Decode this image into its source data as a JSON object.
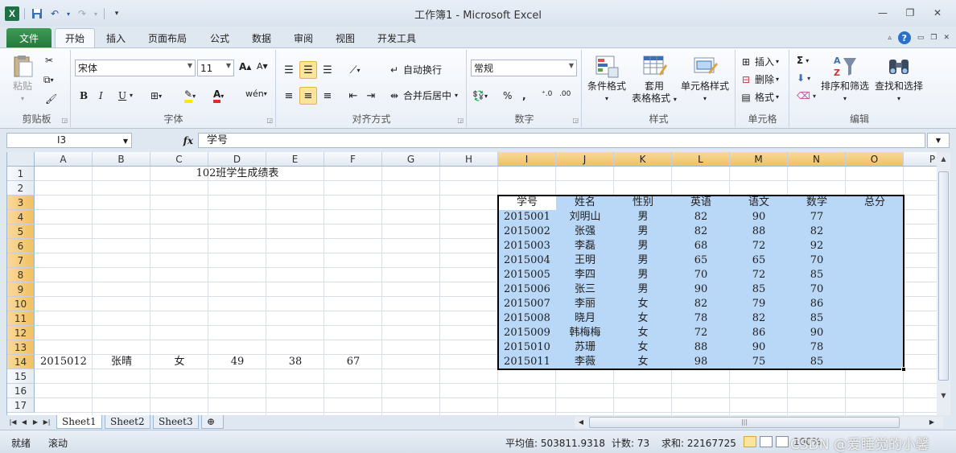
{
  "window": {
    "title": "工作簿1  -  Microsoft Excel",
    "logo": "X",
    "qat": [
      "save-icon",
      "undo-icon",
      "redo-icon",
      "customize-icon"
    ]
  },
  "tabs": {
    "file": "文件",
    "items": [
      "开始",
      "插入",
      "页面布局",
      "公式",
      "数据",
      "审阅",
      "视图",
      "开发工具"
    ]
  },
  "ribbon": {
    "clipboard": {
      "label": "剪贴板",
      "paste": "粘贴"
    },
    "font": {
      "label": "字体",
      "name": "宋体",
      "size": "11",
      "bold": "B",
      "italic": "I",
      "underline": "U"
    },
    "alignment": {
      "label": "对齐方式",
      "wrap": "自动换行",
      "merge": "合并后居中"
    },
    "number": {
      "label": "数字",
      "format": "常规",
      "percent": "%",
      "comma": ","
    },
    "styles": {
      "label": "样式",
      "conditional": "条件格式",
      "table_line1": "套用",
      "table_line2": "表格格式",
      "cell_styles": "单元格样式"
    },
    "cells": {
      "label": "单元格",
      "insert": "插入",
      "delete": "删除",
      "format": "格式"
    },
    "editing": {
      "label": "编辑",
      "sum": "Σ",
      "sort": "排序和筛选",
      "find": "查找和选择"
    }
  },
  "formula_bar": {
    "name_box": "I3",
    "fx": "fx",
    "content": "学号"
  },
  "grid": {
    "columns": [
      "A",
      "B",
      "C",
      "D",
      "E",
      "F",
      "G",
      "H",
      "I",
      "J",
      "K",
      "L",
      "M",
      "N",
      "O",
      "P"
    ],
    "rows": [
      "1",
      "2",
      "3",
      "4",
      "5",
      "6",
      "7",
      "8",
      "9",
      "10",
      "11",
      "12",
      "13",
      "14",
      "15",
      "16",
      "17"
    ],
    "selected_columns": [
      "I",
      "J",
      "K",
      "L",
      "M",
      "N",
      "O"
    ],
    "selected_rows": [
      "3",
      "4",
      "5",
      "6",
      "7",
      "8",
      "9",
      "10",
      "11",
      "12",
      "13",
      "14"
    ],
    "title_cell": {
      "ref": "C1",
      "value": "102班学生成绩表"
    },
    "row14": [
      "2015012",
      "张晴",
      "女",
      "49",
      "38",
      "67"
    ],
    "table": {
      "headers": [
        "学号",
        "姓名",
        "性别",
        "英语",
        "语文",
        "数学",
        "总分"
      ],
      "rows": [
        [
          "2015001",
          "刘明山",
          "男",
          "82",
          "90",
          "77",
          ""
        ],
        [
          "2015002",
          "张强",
          "男",
          "82",
          "88",
          "82",
          ""
        ],
        [
          "2015003",
          "李磊",
          "男",
          "68",
          "72",
          "92",
          ""
        ],
        [
          "2015004",
          "王明",
          "男",
          "65",
          "65",
          "70",
          ""
        ],
        [
          "2015005",
          "李四",
          "男",
          "70",
          "72",
          "85",
          ""
        ],
        [
          "2015006",
          "张三",
          "男",
          "90",
          "85",
          "70",
          ""
        ],
        [
          "2015007",
          "李丽",
          "女",
          "82",
          "79",
          "86",
          ""
        ],
        [
          "2015008",
          "晓月",
          "女",
          "78",
          "82",
          "85",
          ""
        ],
        [
          "2015009",
          "韩梅梅",
          "女",
          "72",
          "86",
          "90",
          ""
        ],
        [
          "2015010",
          "苏珊",
          "女",
          "88",
          "90",
          "78",
          ""
        ],
        [
          "2015011",
          "李薇",
          "女",
          "98",
          "75",
          "85",
          ""
        ]
      ]
    }
  },
  "sheets": [
    "Sheet1",
    "Sheet2",
    "Sheet3"
  ],
  "active_sheet": "Sheet1",
  "status": {
    "ready": "就绪",
    "scroll": "滚动",
    "average": "平均值: 503811.9318",
    "count": "计数: 73",
    "sum": "求和: 22167725",
    "zoom": "100%",
    "watermark": "CSDN @爱睡觉的小馨"
  },
  "colors": {
    "accent": "#1e7145",
    "selection": "#b9d7f7",
    "header_selected": "#f1c15f"
  }
}
